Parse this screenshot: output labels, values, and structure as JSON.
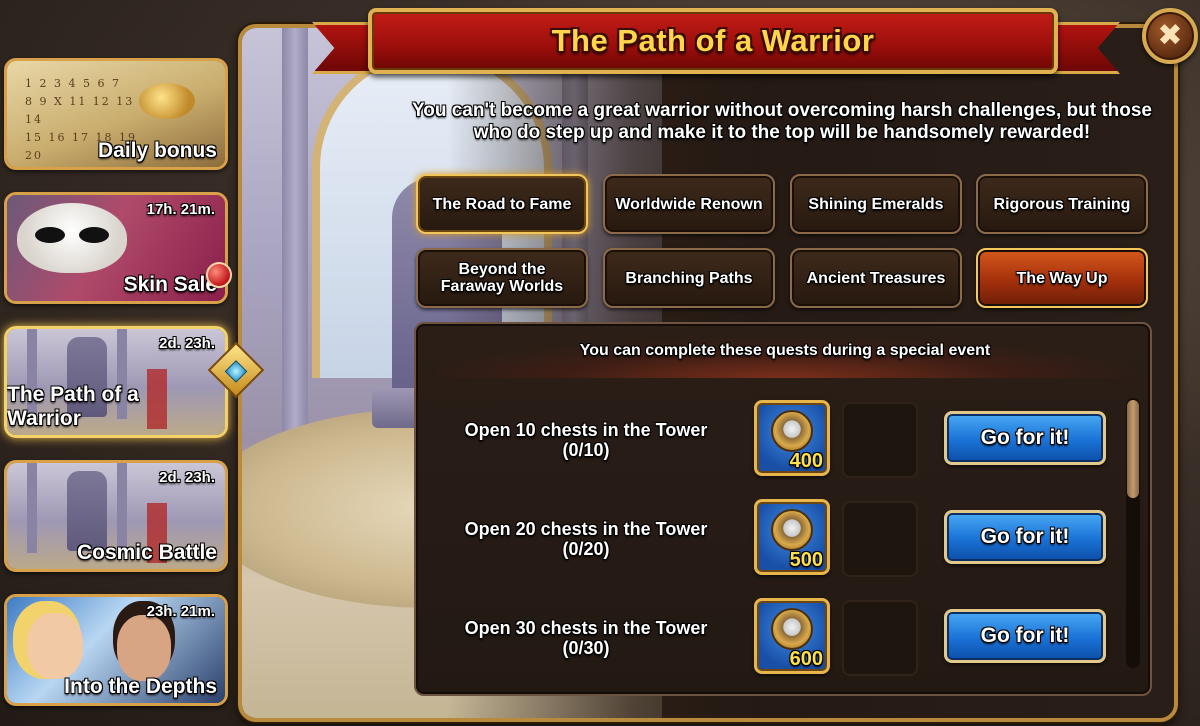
{
  "window": {
    "title": "The Path of a Warrior",
    "close_label": "✖"
  },
  "events": [
    {
      "title": "Daily bonus",
      "timer": ""
    },
    {
      "title": "Skin Sale",
      "timer": "17h. 21m."
    },
    {
      "title": "The Path of a Warrior",
      "timer": "2d. 23h."
    },
    {
      "title": "Cosmic Battle",
      "timer": "2d. 23h."
    },
    {
      "title": "Into the Depths",
      "timer": "23h. 21m."
    }
  ],
  "intro_text": "You can't become a great warrior without overcoming harsh challenges, but those who do step up and make it to the top will be handsomely rewarded!",
  "tabs": [
    {
      "label": "The Road to Fame",
      "state": "selected"
    },
    {
      "label": "Worldwide Renown",
      "state": "normal"
    },
    {
      "label": "Shining Emeralds",
      "state": "normal"
    },
    {
      "label": "Rigorous Training",
      "state": "normal"
    },
    {
      "label": "Beyond the Faraway Worlds",
      "state": "normal"
    },
    {
      "label": "Branching Paths",
      "state": "normal"
    },
    {
      "label": "Ancient Treasures",
      "state": "normal"
    },
    {
      "label": "The Way Up",
      "state": "highlight"
    }
  ],
  "quests": {
    "header": "You can complete these quests during a special event",
    "items": [
      {
        "task": "Open 10 chests in the Tower",
        "progress": "(0/10)",
        "reward": "400",
        "button": "Go for it!"
      },
      {
        "task": "Open 20 chests in the Tower",
        "progress": "(0/20)",
        "reward": "500",
        "button": "Go for it!"
      },
      {
        "task": "Open 30 chests in the Tower",
        "progress": "(0/30)",
        "reward": "600",
        "button": "Go for it!"
      }
    ]
  },
  "colors": {
    "title_gold": "#ffd54a",
    "banner_red": "#b2130f",
    "button_blue": "#1a72d6",
    "tab_highlight_orange": "#d6591c",
    "frame_gold": "#d9a04a"
  }
}
